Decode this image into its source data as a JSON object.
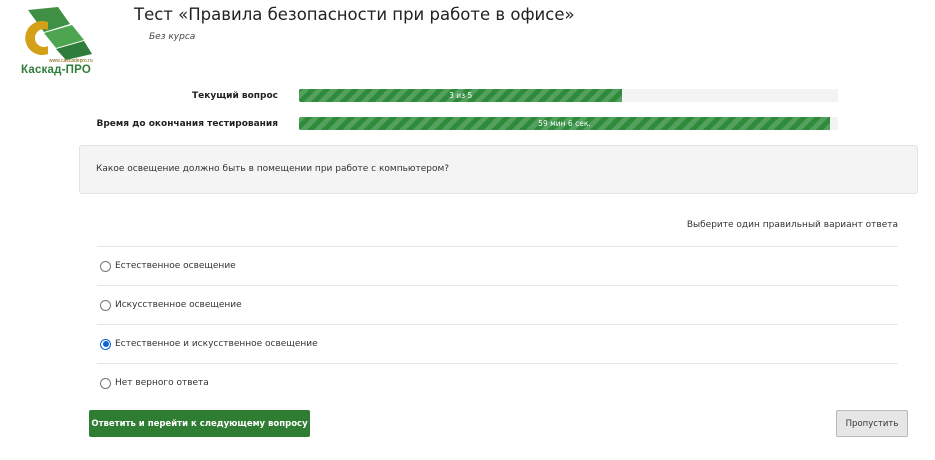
{
  "logo": {
    "url": "www.cascadepro.ru",
    "name": "Каскад-ПРО"
  },
  "test": {
    "title": "Тест «Правила безопасности при работе в офисе»",
    "course": "Без курса"
  },
  "progress": {
    "question_label": "Текущий вопрос",
    "question_text": "3 из 5",
    "question_fraction": 0.6,
    "time_label": "Время до окончания тестирования",
    "time_text": "59 мин 6 сек.",
    "time_fraction": 0.985
  },
  "question": {
    "text": "Какое освещение должно быть в помещении при работе с компьютером?"
  },
  "hint": "Выберите один правильный вариант ответа",
  "answers": [
    {
      "label": "Естественное освещение",
      "selected": false
    },
    {
      "label": "Искусственное освещение",
      "selected": false
    },
    {
      "label": "Естественное и искусственное освещение",
      "selected": true
    },
    {
      "label": "Нет верного ответа",
      "selected": false
    }
  ],
  "buttons": {
    "submit": "Ответить и перейти к следующему вопросу",
    "skip": "Пропустить"
  },
  "colors": {
    "accent_green": "#2e7d32",
    "progress_green": "#2e8b3c",
    "radio_blue": "#0a66d8",
    "logo_gold": "#d4a017"
  }
}
